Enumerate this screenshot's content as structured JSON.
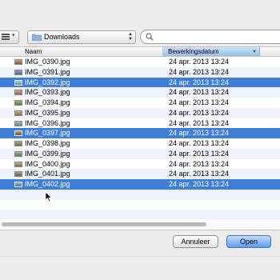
{
  "toolbar": {
    "view_icon": "list-view-icon",
    "location_label": "Downloads",
    "search_placeholder": ""
  },
  "columns": {
    "name": "Naam",
    "date": "Bewerkingsdatum",
    "sort": "descending"
  },
  "files": [
    {
      "name": "IMG_0390.jpg",
      "date": "24 apr. 2013 13:24",
      "selected": false
    },
    {
      "name": "IMG_0391.jpg",
      "date": "24 apr. 2013 13:24",
      "selected": false
    },
    {
      "name": "IMG_0392.jpg",
      "date": "24 apr. 2013 13:24",
      "selected": true
    },
    {
      "name": "IMG_0393.jpg",
      "date": "24 apr. 2013 13:24",
      "selected": false
    },
    {
      "name": "IMG_0394.jpg",
      "date": "24 apr. 2013 13:24",
      "selected": false
    },
    {
      "name": "IMG_0395.jpg",
      "date": "24 apr. 2013 13:24",
      "selected": false
    },
    {
      "name": "IMG_0396.jpg",
      "date": "24 apr. 2013 13:24",
      "selected": false
    },
    {
      "name": "IMG_0397.jpg",
      "date": "24 apr. 2013 13:24",
      "selected": true
    },
    {
      "name": "IMG_0398.jpg",
      "date": "24 apr. 2013 13:24",
      "selected": false
    },
    {
      "name": "IMG_0399.jpg",
      "date": "24 apr. 2013 13:24",
      "selected": false
    },
    {
      "name": "IMG_0400.jpg",
      "date": "24 apr. 2013 13:24",
      "selected": false
    },
    {
      "name": "IMG_0401.jpg",
      "date": "24 apr. 2013 13:24",
      "selected": false
    },
    {
      "name": "IMG_0402.jpg",
      "date": "24 apr. 2013 13:24",
      "selected": true
    }
  ],
  "buttons": {
    "cancel": "Annuleer",
    "open": "Open"
  },
  "colors": {
    "selection": "#3f7ed8",
    "sorted_header": "#96bde7"
  }
}
